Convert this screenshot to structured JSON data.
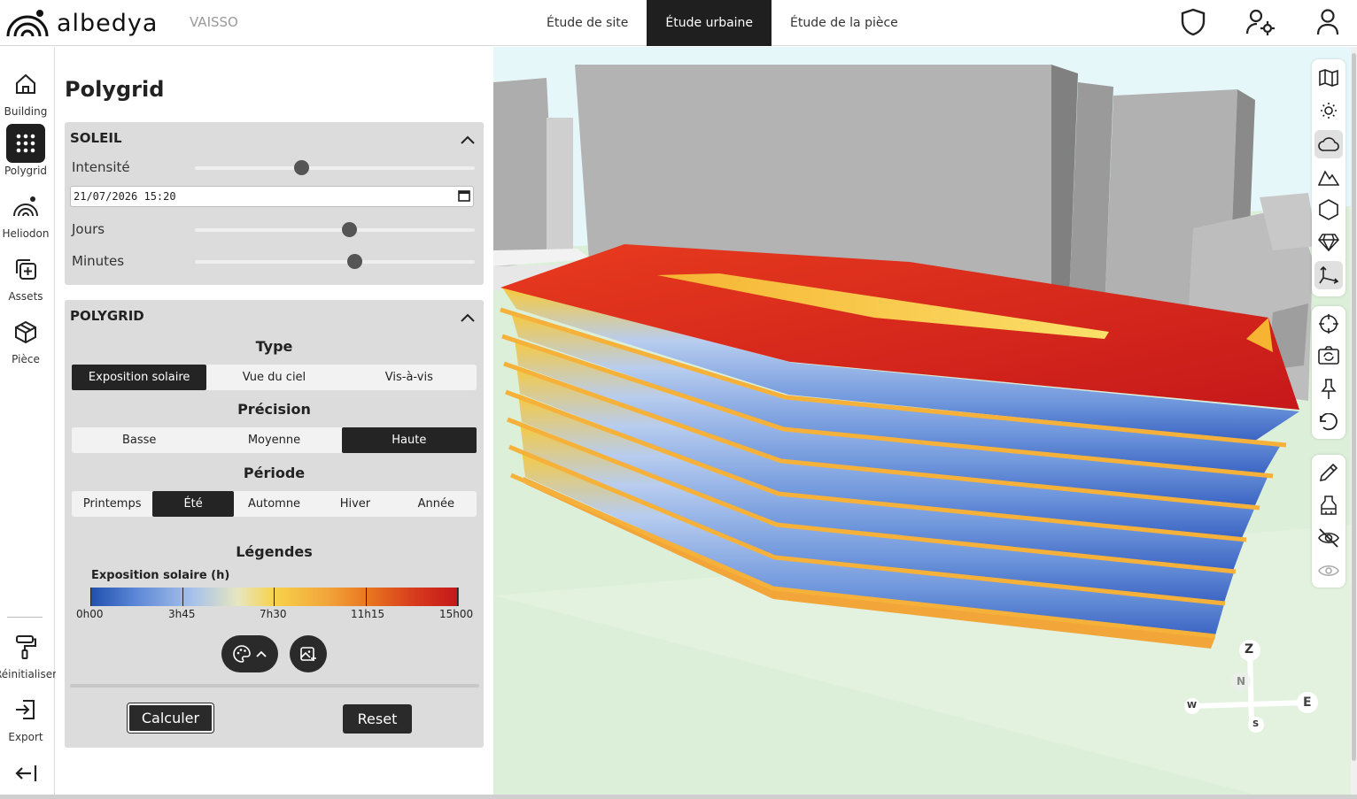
{
  "app": {
    "brand": "albedya",
    "project": "VAISSO"
  },
  "nav": {
    "tabs": [
      "Étude de site",
      "Étude urbaine",
      "Étude de la pièce"
    ],
    "active": 1
  },
  "rail": {
    "items": [
      {
        "label": "Building",
        "icon": "home-icon"
      },
      {
        "label": "Polygrid",
        "icon": "grid-dots-icon"
      },
      {
        "label": "Heliodon",
        "icon": "heliodon-icon"
      },
      {
        "label": "Assets",
        "icon": "add-asset-icon"
      },
      {
        "label": "Pièce",
        "icon": "cube-icon"
      },
      {
        "label": "Réinitialiser",
        "icon": "paint-roller-icon"
      },
      {
        "label": "Export",
        "icon": "export-icon"
      }
    ],
    "active": 1
  },
  "panel": {
    "title": "Polygrid",
    "soleil": {
      "header": "SOLEIL",
      "intensite_label": "Intensité",
      "intensite_value": 0.38,
      "datetime": "21/07/2026 15:20",
      "jours_label": "Jours",
      "jours_value": 0.55,
      "minutes_label": "Minutes",
      "minutes_value": 0.57
    },
    "polygrid": {
      "header": "POLYGRID",
      "type_title": "Type",
      "type_options": [
        "Exposition solaire",
        "Vue du ciel",
        "Vis-à-vis"
      ],
      "type_selected": 0,
      "precision_title": "Précision",
      "precision_options": [
        "Basse",
        "Moyenne",
        "Haute"
      ],
      "precision_selected": 2,
      "periode_title": "Période",
      "periode_options": [
        "Printemps",
        "Été",
        "Automne",
        "Hiver",
        "Année"
      ],
      "periode_selected": 1,
      "legend_title": "Légendes",
      "legend_label": "Exposition solaire (h)",
      "legend_ticks": [
        "0h00",
        "3h45",
        "7h30",
        "11h15",
        "15h00"
      ],
      "calc_label": "Calculer",
      "reset_label": "Reset"
    }
  },
  "compass": {
    "z": "Z",
    "n": "N",
    "e": "E",
    "s": "S",
    "w": "W"
  },
  "colors": {
    "dark": "#1f1f1f",
    "panel_bg": "#dcdcdc",
    "roof": "#d22a1c",
    "sky": "#e9f8fb"
  }
}
